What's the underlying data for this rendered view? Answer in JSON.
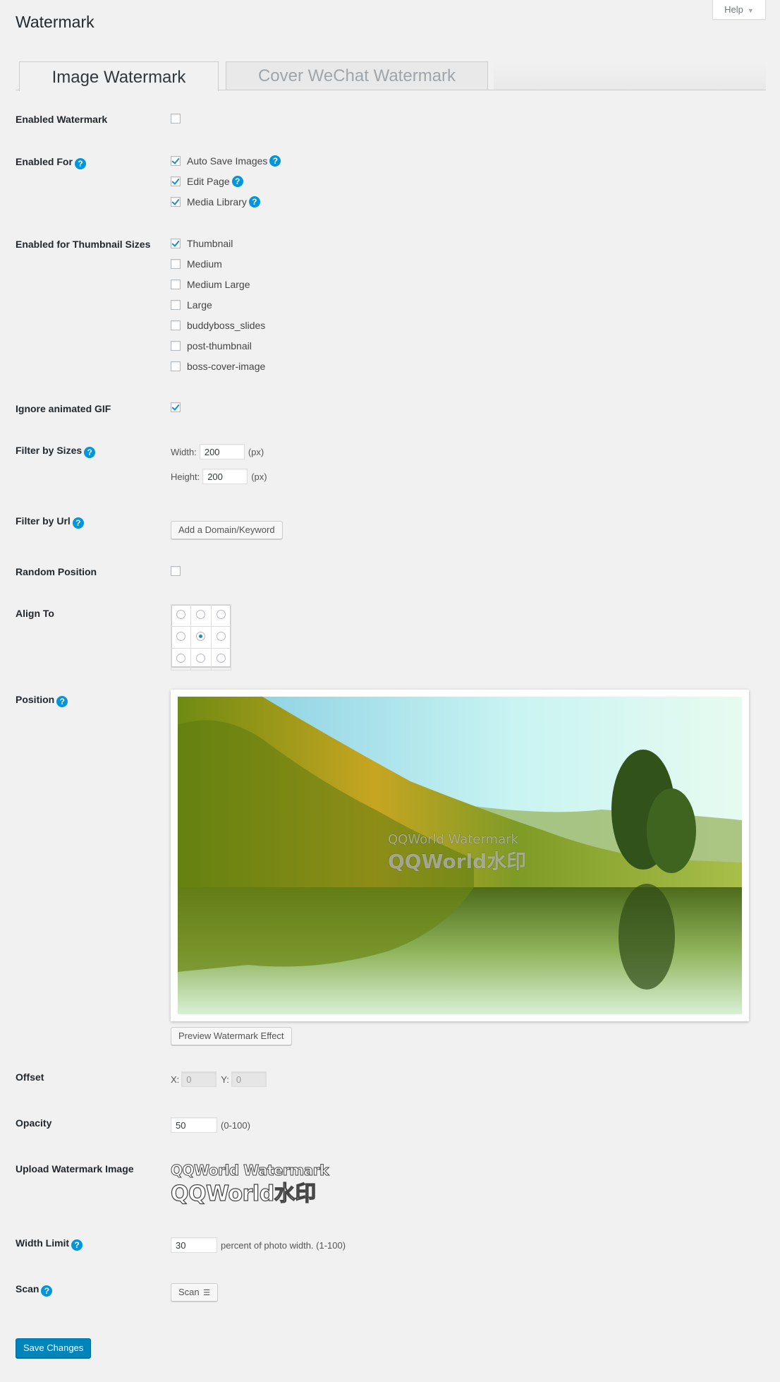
{
  "page": {
    "title": "Watermark",
    "help_label": "Help"
  },
  "tabs": [
    {
      "label": "Image Watermark",
      "active": true
    },
    {
      "label": "Cover WeChat Watermark",
      "active": false
    }
  ],
  "settings": {
    "enabled_watermark": {
      "label": "Enabled Watermark",
      "checked": false
    },
    "enabled_for": {
      "label": "Enabled For",
      "options": [
        {
          "label": "Auto Save Images",
          "checked": true
        },
        {
          "label": "Edit Page",
          "checked": true
        },
        {
          "label": "Media Library",
          "checked": true
        }
      ]
    },
    "thumbnail_sizes": {
      "label": "Enabled for Thumbnail Sizes",
      "options": [
        {
          "label": "Thumbnail",
          "checked": true
        },
        {
          "label": "Medium",
          "checked": false
        },
        {
          "label": "Medium Large",
          "checked": false
        },
        {
          "label": "Large",
          "checked": false
        },
        {
          "label": "buddyboss_slides",
          "checked": false
        },
        {
          "label": "post-thumbnail",
          "checked": false
        },
        {
          "label": "boss-cover-image",
          "checked": false
        }
      ]
    },
    "ignore_gif": {
      "label": "Ignore animated GIF",
      "checked": true
    },
    "filter_sizes": {
      "label": "Filter by Sizes",
      "width_label": "Width:",
      "width_value": "200",
      "height_label": "Height:",
      "height_value": "200",
      "unit": "(px)"
    },
    "filter_url": {
      "label": "Filter by Url",
      "button": "Add a Domain/Keyword"
    },
    "random_position": {
      "label": "Random Position",
      "checked": false
    },
    "align_to": {
      "label": "Align To",
      "selected": "middle-center"
    },
    "position": {
      "label": "Position",
      "watermark_line1": "QQWorld Watermark",
      "watermark_line2": "QQWorld水印",
      "preview_button": "Preview Watermark Effect"
    },
    "offset": {
      "label": "Offset",
      "x_label": "X:",
      "x_value": "0",
      "y_label": "Y:",
      "y_value": "0"
    },
    "opacity": {
      "label": "Opacity",
      "value": "50",
      "hint": "(0-100)"
    },
    "upload": {
      "label": "Upload Watermark Image",
      "line1": "QQWorld Watermark",
      "line2": "QQWorld水印"
    },
    "width_limit": {
      "label": "Width Limit",
      "value": "30",
      "hint": "percent of photo width. (1-100)"
    },
    "scan": {
      "label": "Scan",
      "button": "Scan"
    }
  },
  "save_button": "Save Changes",
  "colors": {
    "accent": "#0085ba",
    "help_icon": "#0096dd",
    "check": "#1e8cbe"
  }
}
